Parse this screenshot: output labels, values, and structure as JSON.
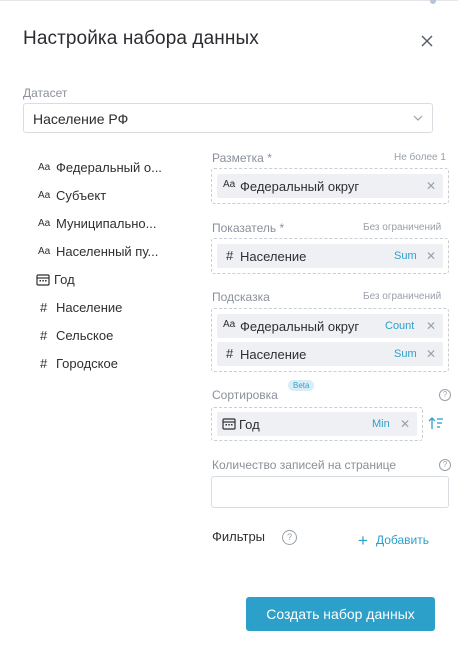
{
  "dialog": {
    "title": "Настройка набора данных"
  },
  "dataset": {
    "label": "Датасет",
    "value": "Население РФ"
  },
  "fields": [
    {
      "icon": "Aa",
      "label": "Федеральный о..."
    },
    {
      "icon": "Aa",
      "label": "Субъект"
    },
    {
      "icon": "Aa",
      "label": "Муниципально..."
    },
    {
      "icon": "Aa",
      "label": "Населенный пу..."
    },
    {
      "icon": "calendar-icon",
      "label": "Год"
    },
    {
      "icon": "#",
      "label": "Население"
    },
    {
      "icon": "#",
      "label": "Сельское"
    },
    {
      "icon": "#",
      "label": "Городское"
    }
  ],
  "markup": {
    "label": "Разметка *",
    "hint": "Не более 1",
    "chips": [
      {
        "icon": "Aa",
        "name": "Федеральный округ"
      }
    ]
  },
  "indicator": {
    "label": "Показатель *",
    "hint": "Без ограничений",
    "chips": [
      {
        "icon": "#",
        "name": "Население",
        "agg": "Sum"
      }
    ]
  },
  "tooltip": {
    "label": "Подсказка",
    "hint": "Без ограничений",
    "chips": [
      {
        "icon": "Aa",
        "name": "Федеральный округ",
        "agg": "Count"
      },
      {
        "icon": "#",
        "name": "Население",
        "agg": "Sum"
      }
    ]
  },
  "sorting": {
    "label": "Сортировка",
    "badge": "Beta",
    "chips": [
      {
        "icon": "calendar-icon",
        "name": "Год",
        "agg": "Min"
      }
    ]
  },
  "page_size": {
    "label": "Количество записей на странице",
    "value": ""
  },
  "filters": {
    "label": "Фильтры",
    "add_label": "Добавить"
  },
  "actions": {
    "create_label": "Создать набор данных"
  },
  "colors": {
    "accent": "#2ca0c9",
    "chip_bg": "#eef0f4",
    "border": "#d9dce1"
  }
}
